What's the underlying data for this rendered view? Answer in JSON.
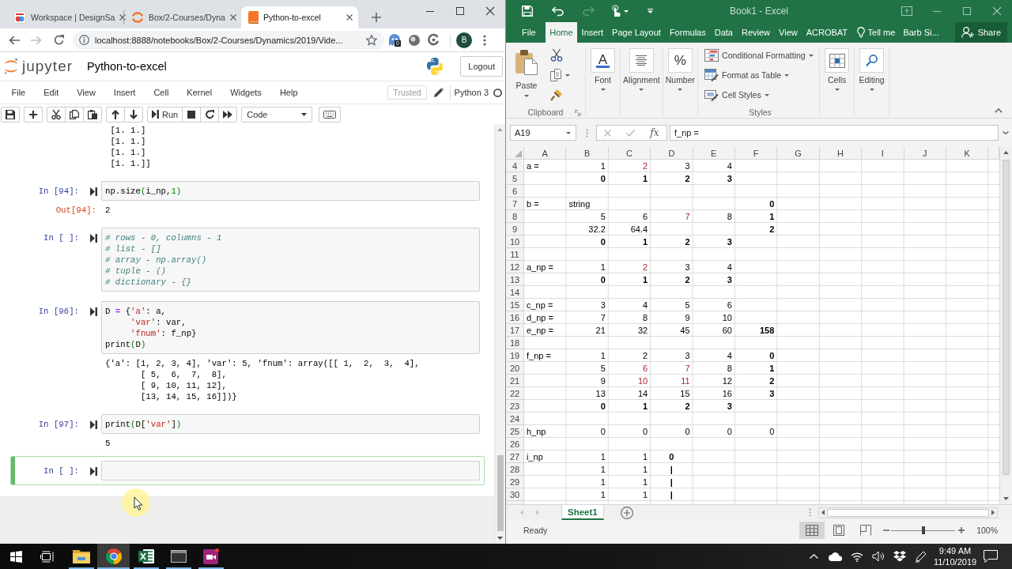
{
  "browser": {
    "tabs": [
      {
        "title": "Workspace | DesignSa",
        "selected": false
      },
      {
        "title": "Box/2-Courses/Dyna",
        "selected": false
      },
      {
        "title": "Python-to-excel",
        "selected": true
      }
    ],
    "back_disabled": false,
    "forward_disabled": true,
    "address": "localhost:8888/notebooks/Box/2-Courses/Dynamics/2019/Vide...",
    "extension_badge": "0",
    "profile_initial": "B"
  },
  "notebook": {
    "logo_text": "jupyter",
    "title": "Python-to-excel",
    "logout_button": "Logout",
    "menu": [
      "File",
      "Edit",
      "View",
      "Insert",
      "Cell",
      "Kernel",
      "Widgets",
      "Help"
    ],
    "trusted": "Trusted",
    "kernel": "Python 3",
    "kernel_busy": false,
    "run_button": "Run",
    "cell_type": "Code",
    "cells": [
      {
        "kind": "output",
        "output": [
          " [1. 1.]",
          " [1. 1.]",
          " [1. 1.]",
          " [1. 1.]]"
        ]
      },
      {
        "kind": "code",
        "selected": false,
        "prompt": "In [94]:",
        "source": [
          "np.size(i_np,1)"
        ],
        "output_prompt": "Out[94]:",
        "output": [
          "2"
        ]
      },
      {
        "kind": "code",
        "selected": false,
        "prompt": "In [ ]:",
        "source": [
          "# rows - 0, columns - 1",
          "# list - []",
          "# array - np.array()",
          "# tuple - ()",
          "# dictionary - {}"
        ]
      },
      {
        "kind": "code",
        "selected": false,
        "prompt": "In [96]:",
        "source": [
          "D = {'a': a,",
          "     'var': var,",
          "     'fnum': f_np}",
          "print(D)"
        ],
        "output": [
          "{'a': [1, 2, 3, 4], 'var': 5, 'fnum': array([[ 1,  2,  3,  4],",
          "       [ 5,  6,  7,  8],",
          "       [ 9, 10, 11, 12],",
          "       [13, 14, 15, 16]])}"
        ]
      },
      {
        "kind": "code",
        "selected": false,
        "prompt": "In [97]:",
        "source": [
          "print(D['var'])"
        ],
        "output": [
          "5"
        ]
      },
      {
        "kind": "code",
        "selected": true,
        "prompt": "In [ ]:"
      }
    ]
  },
  "excel": {
    "title": "Book1 - Excel",
    "redo_disabled": true,
    "ribbon_tabs": [
      {
        "label": "File",
        "selected": false
      },
      {
        "label": "Home",
        "selected": true
      },
      {
        "label": "Insert",
        "selected": false
      },
      {
        "label": "Page Layout",
        "selected": false
      },
      {
        "label": "Formulas",
        "selected": false
      },
      {
        "label": "Data",
        "selected": false
      },
      {
        "label": "Review",
        "selected": false
      },
      {
        "label": "View",
        "selected": false
      },
      {
        "label": "ACROBAT",
        "selected": false
      }
    ],
    "tell_me": "Tell me",
    "account": "Barb Si...",
    "share_button": "Share",
    "ribbon": [
      {
        "kind": "clipboard",
        "paste": "Paste",
        "label": "Clipboard"
      },
      {
        "kind": "collapsed",
        "glyph": "A",
        "label": "Font"
      },
      {
        "kind": "collapsed",
        "label": "Alignment"
      },
      {
        "kind": "collapsed",
        "glyph": "%",
        "label": "Number"
      },
      {
        "kind": "list",
        "items": [
          "Conditional Formatting",
          "Format as Table",
          "Cell Styles"
        ],
        "label": "Styles"
      },
      {
        "kind": "collapsed",
        "label": "Cells"
      },
      {
        "kind": "collapsed",
        "label": "Editing"
      }
    ],
    "name_box": "A19",
    "formula_buttons_disabled": true,
    "function_button": "fx",
    "formula": "f_np =",
    "columns": [
      "A",
      "B",
      "C",
      "D",
      "E",
      "F",
      "G",
      "H",
      "I",
      "J",
      "K"
    ],
    "rows": [
      {
        "header": "4",
        "cells": [
          {
            "kind": "text",
            "text": "a ="
          },
          {
            "kind": "number",
            "text": "1"
          },
          {
            "kind": "highlighted",
            "text": "2"
          },
          {
            "kind": "number",
            "text": "3"
          },
          {
            "kind": "number",
            "text": "4"
          }
        ]
      },
      {
        "header": "5",
        "cells": [
          null,
          {
            "kind": "total",
            "text": "0"
          },
          {
            "kind": "total",
            "text": "1"
          },
          {
            "kind": "total",
            "text": "2"
          },
          {
            "kind": "total",
            "text": "3"
          }
        ]
      },
      {
        "header": "6"
      },
      {
        "header": "7",
        "cells": [
          {
            "kind": "text",
            "text": "b ="
          },
          {
            "kind": "text",
            "text": "string"
          },
          null,
          null,
          null,
          {
            "kind": "total",
            "text": "0"
          }
        ]
      },
      {
        "header": "8",
        "cells": [
          null,
          {
            "kind": "number",
            "text": "5"
          },
          {
            "kind": "number",
            "text": "6"
          },
          {
            "kind": "highlighted",
            "text": "7"
          },
          {
            "kind": "number",
            "text": "8"
          },
          {
            "kind": "total",
            "text": "1"
          }
        ]
      },
      {
        "header": "9",
        "cells": [
          null,
          {
            "kind": "number",
            "text": "32.2"
          },
          {
            "kind": "number",
            "text": "64.4"
          },
          null,
          null,
          {
            "kind": "total",
            "text": "2"
          }
        ]
      },
      {
        "header": "10",
        "cells": [
          null,
          {
            "kind": "total",
            "text": "0"
          },
          {
            "kind": "total",
            "text": "1"
          },
          {
            "kind": "total",
            "text": "2"
          },
          {
            "kind": "total",
            "text": "3"
          }
        ]
      },
      {
        "header": "11"
      },
      {
        "header": "12",
        "cells": [
          {
            "kind": "text",
            "text": "a_np ="
          },
          {
            "kind": "number",
            "text": "1"
          },
          {
            "kind": "highlighted",
            "text": "2"
          },
          {
            "kind": "number",
            "text": "3"
          },
          {
            "kind": "number",
            "text": "4"
          }
        ]
      },
      {
        "header": "13",
        "cells": [
          null,
          {
            "kind": "total",
            "text": "0"
          },
          {
            "kind": "total",
            "text": "1"
          },
          {
            "kind": "total",
            "text": "2"
          },
          {
            "kind": "total",
            "text": "3"
          }
        ]
      },
      {
        "header": "14"
      },
      {
        "header": "15",
        "cells": [
          {
            "kind": "text",
            "text": "c_np ="
          },
          {
            "kind": "number",
            "text": "3"
          },
          {
            "kind": "number",
            "text": "4"
          },
          {
            "kind": "number",
            "text": "5"
          },
          {
            "kind": "number",
            "text": "6"
          }
        ]
      },
      {
        "header": "16",
        "cells": [
          {
            "kind": "text",
            "text": "d_np ="
          },
          {
            "kind": "number",
            "text": "7"
          },
          {
            "kind": "number",
            "text": "8"
          },
          {
            "kind": "number",
            "text": "9"
          },
          {
            "kind": "number",
            "text": "10"
          }
        ]
      },
      {
        "header": "17",
        "cells": [
          {
            "kind": "text",
            "text": "e_np ="
          },
          {
            "kind": "number",
            "text": "21"
          },
          {
            "kind": "number",
            "text": "32"
          },
          {
            "kind": "number",
            "text": "45"
          },
          {
            "kind": "number",
            "text": "60"
          },
          {
            "kind": "total",
            "text": "158"
          }
        ]
      },
      {
        "header": "18"
      },
      {
        "header": "19",
        "cells": [
          {
            "kind": "text",
            "text": "f_np ="
          },
          {
            "kind": "number",
            "text": "1"
          },
          {
            "kind": "number",
            "text": "2"
          },
          {
            "kind": "number",
            "text": "3"
          },
          {
            "kind": "number",
            "text": "4"
          },
          {
            "kind": "total",
            "text": "0"
          }
        ]
      },
      {
        "header": "20",
        "cells": [
          null,
          {
            "kind": "number",
            "text": "5"
          },
          {
            "kind": "highlighted",
            "text": "6"
          },
          {
            "kind": "highlighted",
            "text": "7"
          },
          {
            "kind": "number",
            "text": "8"
          },
          {
            "kind": "total",
            "text": "1"
          }
        ]
      },
      {
        "header": "21",
        "cells": [
          null,
          {
            "kind": "number",
            "text": "9"
          },
          {
            "kind": "highlighted",
            "text": "10"
          },
          {
            "kind": "highlighted",
            "text": "11"
          },
          {
            "kind": "number",
            "text": "12"
          },
          {
            "kind": "total",
            "text": "2"
          }
        ]
      },
      {
        "header": "22",
        "cells": [
          null,
          {
            "kind": "number",
            "text": "13"
          },
          {
            "kind": "number",
            "text": "14"
          },
          {
            "kind": "number",
            "text": "15"
          },
          {
            "kind": "number",
            "text": "16"
          },
          {
            "kind": "total",
            "text": "3"
          }
        ]
      },
      {
        "header": "23",
        "cells": [
          null,
          {
            "kind": "total",
            "text": "0"
          },
          {
            "kind": "total",
            "text": "1"
          },
          {
            "kind": "total",
            "text": "2"
          },
          {
            "kind": "total",
            "text": "3"
          }
        ]
      },
      {
        "header": "24"
      },
      {
        "header": "25",
        "cells": [
          {
            "kind": "text",
            "text": "h_np"
          },
          {
            "kind": "number",
            "text": "0"
          },
          {
            "kind": "number",
            "text": "0"
          },
          {
            "kind": "number",
            "text": "0"
          },
          {
            "kind": "number",
            "text": "0"
          },
          {
            "kind": "number",
            "text": "0"
          }
        ]
      },
      {
        "header": "26"
      },
      {
        "header": "27",
        "cells": [
          {
            "kind": "text",
            "text": "i_np"
          },
          {
            "kind": "number",
            "text": "1"
          },
          {
            "kind": "number",
            "text": "1"
          },
          {
            "kind": "marker",
            "text": "0"
          }
        ]
      },
      {
        "header": "28",
        "cells": [
          null,
          {
            "kind": "number",
            "text": "1"
          },
          {
            "kind": "number",
            "text": "1"
          },
          {
            "kind": "marker",
            "text": "|"
          }
        ]
      },
      {
        "header": "29",
        "cells": [
          null,
          {
            "kind": "number",
            "text": "1"
          },
          {
            "kind": "number",
            "text": "1"
          },
          {
            "kind": "marker",
            "text": "|"
          }
        ]
      },
      {
        "header": "30",
        "cells": [
          null,
          {
            "kind": "number",
            "text": "1"
          },
          {
            "kind": "number",
            "text": "1"
          },
          {
            "kind": "marker",
            "text": "|"
          }
        ]
      }
    ],
    "sheet_nav_disabled": true,
    "sheet_tabs": [
      {
        "label": "Sheet1",
        "selected": true
      }
    ],
    "status": "Ready",
    "views": [
      {
        "selected": true
      },
      {
        "selected": false
      },
      {
        "selected": false
      }
    ],
    "zoom": {
      "level": 0.5,
      "reading": "100%"
    }
  },
  "taskbar": {
    "apps": [
      {
        "selected": false,
        "running": true
      },
      {
        "selected": true,
        "running": true
      },
      {
        "selected": false,
        "running": true
      },
      {
        "selected": false,
        "running": true
      },
      {
        "selected": false,
        "running": true
      }
    ],
    "time": "9:49 AM",
    "date": "11/10/2019"
  }
}
